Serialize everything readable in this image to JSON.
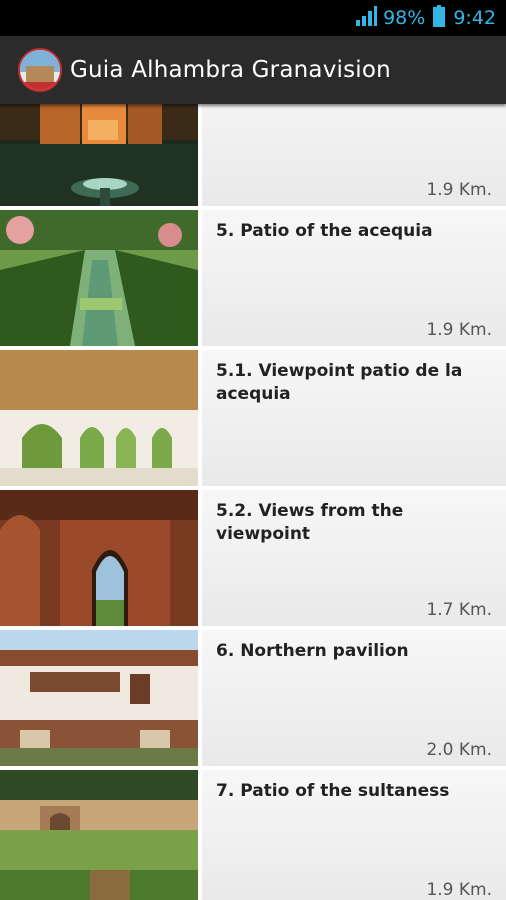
{
  "status_bar": {
    "battery": "98%",
    "time": "9:42",
    "icons": [
      "signal-icon",
      "battery-icon"
    ]
  },
  "action_bar": {
    "title": "Guia Alhambra Granavision",
    "icon": "app-logo-icon"
  },
  "list": {
    "items": [
      {
        "title": "",
        "distance": "1.9 Km."
      },
      {
        "title": "5. Patio of the acequia",
        "distance": "1.9 Km."
      },
      {
        "title": "5.1. Viewpoint patio de la acequia",
        "distance": ""
      },
      {
        "title": "5.2. Views from the viewpoint",
        "distance": "1.7 Km."
      },
      {
        "title": "6. Northern pavilion",
        "distance": "2.0 Km."
      },
      {
        "title": "7. Patio of the sultaness",
        "distance": "1.9 Km."
      }
    ]
  },
  "colors": {
    "status_accent": "#33b5e5",
    "action_bar": "#2b2b2b",
    "row_background": "#f2f2f2"
  }
}
